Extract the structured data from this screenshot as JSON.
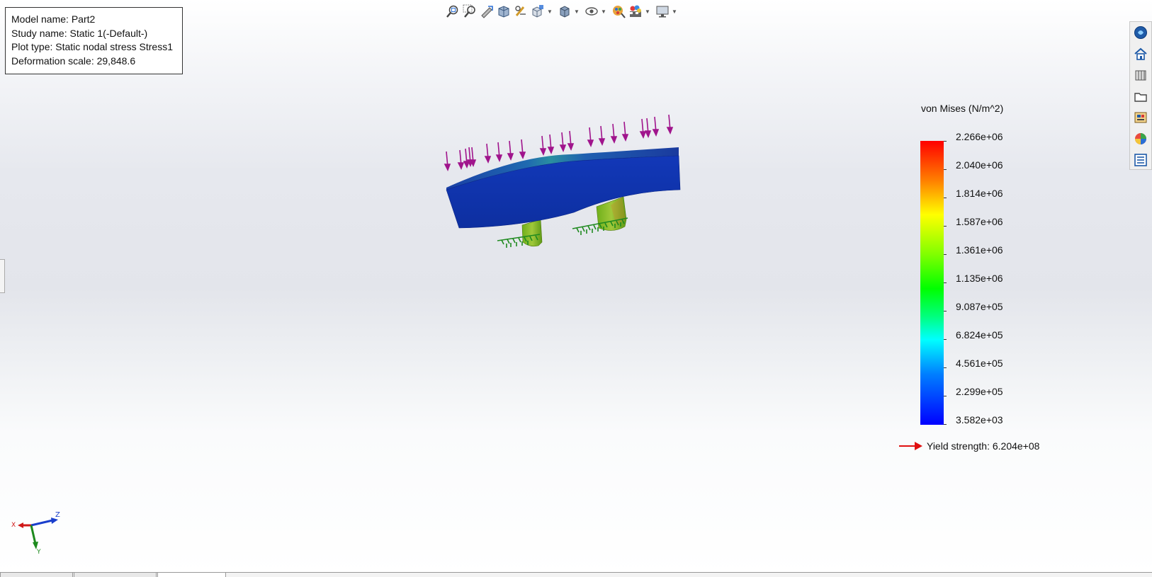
{
  "info_box": {
    "model_name": "Model name: Part2",
    "study_name": "Study name: Static 1(-Default-)",
    "plot_type": "Plot type: Static nodal stress Stress1",
    "deformation_scale": "Deformation scale: 29,848.6"
  },
  "heads_up_toolbar": {
    "icons": [
      "zoom-to-fit-icon",
      "zoom-to-area-icon",
      "previous-view-icon",
      "section-view-icon",
      "dynamic-annotation-views-icon",
      "view-orientation-icon",
      "display-style-icon",
      "hide-show-items-icon",
      "edit-appearance-icon",
      "apply-scene-icon",
      "view-settings-icon"
    ]
  },
  "task_pane": {
    "icons": [
      "solidworks-resources-icon",
      "home-icon",
      "design-library-icon",
      "file-explorer-icon",
      "view-palette-icon",
      "appearances-scenes-icon",
      "custom-properties-icon"
    ]
  },
  "legend": {
    "title": "von Mises (N/m^2)",
    "ticks": [
      "2.266e+06",
      "2.040e+06",
      "1.814e+06",
      "1.587e+06",
      "1.361e+06",
      "1.135e+06",
      "9.087e+05",
      "6.824e+05",
      "4.561e+05",
      "2.299e+05",
      "3.582e+03"
    ],
    "max": 2266000,
    "min": 3582,
    "colors": [
      "#ff0000",
      "#ff8000",
      "#ffff00",
      "#80ff00",
      "#00ff00",
      "#00ff80",
      "#00ffff",
      "#0080ff",
      "#0000ff"
    ],
    "yield_strength": "Yield strength: 6.204e+08",
    "yield_arrow_color": "#ff0000"
  },
  "triad": {
    "x": "X",
    "y": "Y",
    "z": "Z"
  },
  "model_colors": {
    "plate_top": "#1f4fa8",
    "plate_side": "#0f38b0",
    "supports": "#7fbf1e",
    "load_arrows": "#a0148c",
    "fixtures": "#228b22"
  }
}
